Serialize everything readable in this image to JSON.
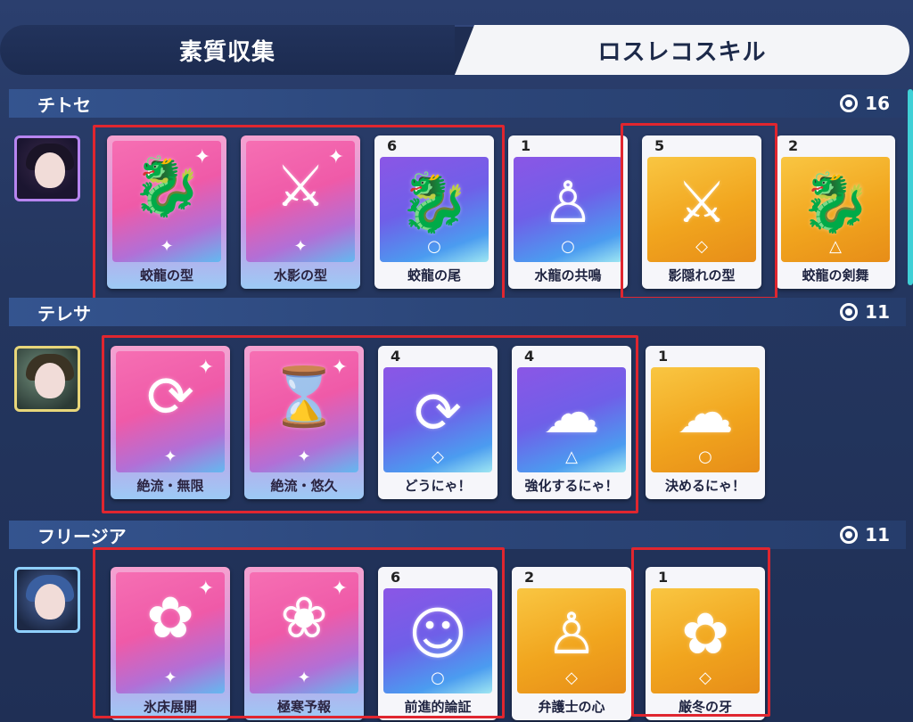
{
  "tabs": [
    {
      "label": "素質収集",
      "active": false
    },
    {
      "label": "ロスレコスキル",
      "active": true
    }
  ],
  "sections": [
    {
      "name": "チトセ",
      "count": "16",
      "cards": [
        {
          "level": "",
          "label": "蛟龍の型",
          "style": "pink",
          "glyph": "dragon-icon",
          "mark": "✦"
        },
        {
          "level": "",
          "label": "水影の型",
          "style": "pink",
          "glyph": "slash-figure-icon",
          "mark": "✦"
        },
        {
          "level": "6",
          "label": "蛟龍の尾",
          "style": "purple",
          "glyph": "dragon-icon",
          "mark": "○"
        },
        {
          "level": "1",
          "label": "水龍の共鳴",
          "style": "purple",
          "glyph": "person-icon",
          "mark": "○"
        },
        {
          "level": "5",
          "label": "影隠れの型",
          "style": "gold",
          "glyph": "slash-figure-icon",
          "mark": "◇"
        },
        {
          "level": "2",
          "label": "蛟龍の剣舞",
          "style": "gold",
          "glyph": "dragon-icon",
          "mark": "△"
        }
      ]
    },
    {
      "name": "テレサ",
      "count": "11",
      "cards": [
        {
          "level": "",
          "label": "絶流・無限",
          "style": "pink",
          "glyph": "cycle-figure-icon",
          "mark": "✦"
        },
        {
          "level": "",
          "label": "絶流・悠久",
          "style": "pink",
          "glyph": "hourglass-icon",
          "mark": "✦"
        },
        {
          "level": "4",
          "label": "どうにゃ！",
          "style": "purple",
          "glyph": "cycle-figure-icon",
          "mark": "◇"
        },
        {
          "level": "4",
          "label": "強化するにゃ！",
          "style": "purple",
          "glyph": "splash-icon",
          "mark": "△"
        },
        {
          "level": "1",
          "label": "決めるにゃ！",
          "style": "gold",
          "glyph": "splash-icon",
          "mark": "○"
        }
      ]
    },
    {
      "name": "フリージア",
      "count": "11",
      "cards": [
        {
          "level": "",
          "label": "氷床展開",
          "style": "pink",
          "glyph": "flower-icon",
          "mark": "✦"
        },
        {
          "level": "",
          "label": "極寒予報",
          "style": "pink",
          "glyph": "flowers-icon",
          "mark": "✦"
        },
        {
          "level": "6",
          "label": "前進的論証",
          "style": "purple",
          "glyph": "group-icon",
          "mark": "○"
        },
        {
          "level": "2",
          "label": "弁護士の心",
          "style": "gold",
          "glyph": "person-icon",
          "mark": "◇"
        },
        {
          "level": "1",
          "label": "厳冬の牙",
          "style": "gold",
          "glyph": "flower-icon",
          "mark": "◇"
        }
      ]
    }
  ],
  "colors": {
    "highlight": "#e0262f",
    "pink": "#f66fb3",
    "purple": "#7b5ae8",
    "gold": "#f2a720"
  }
}
